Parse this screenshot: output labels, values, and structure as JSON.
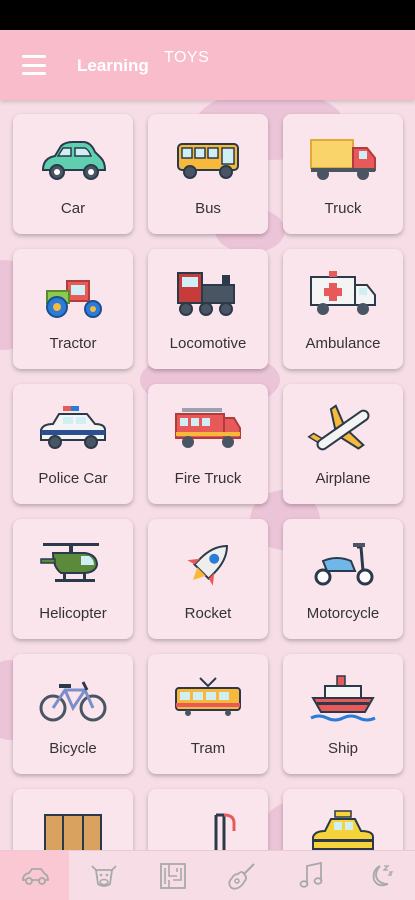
{
  "app_bar": {
    "title": "Learning",
    "subtitle": "TOYS"
  },
  "items": [
    {
      "label": "Car",
      "icon": "car-icon"
    },
    {
      "label": "Bus",
      "icon": "bus-icon"
    },
    {
      "label": "Truck",
      "icon": "truck-icon"
    },
    {
      "label": "Tractor",
      "icon": "tractor-icon"
    },
    {
      "label": "Locomotive",
      "icon": "locomotive-icon"
    },
    {
      "label": "Ambulance",
      "icon": "ambulance-icon"
    },
    {
      "label": "Police Car",
      "icon": "police-car-icon"
    },
    {
      "label": "Fire Truck",
      "icon": "fire-truck-icon"
    },
    {
      "label": "Airplane",
      "icon": "airplane-icon"
    },
    {
      "label": "Helicopter",
      "icon": "helicopter-icon"
    },
    {
      "label": "Rocket",
      "icon": "rocket-icon"
    },
    {
      "label": "Motorcycle",
      "icon": "motorcycle-icon"
    },
    {
      "label": "Bicycle",
      "icon": "bicycle-icon"
    },
    {
      "label": "Tram",
      "icon": "tram-icon"
    },
    {
      "label": "Ship",
      "icon": "ship-icon"
    },
    {
      "label": "",
      "icon": "crate-icon"
    },
    {
      "label": "",
      "icon": "crane-icon"
    },
    {
      "label": "",
      "icon": "taxi-icon"
    }
  ],
  "bottom_nav": [
    {
      "icon": "car-outline-icon",
      "active": true
    },
    {
      "icon": "cow-icon",
      "active": false
    },
    {
      "icon": "maze-icon",
      "active": false
    },
    {
      "icon": "guitar-icon",
      "active": false
    },
    {
      "icon": "music-note-icon",
      "active": false
    },
    {
      "icon": "moon-sleep-icon",
      "active": false
    }
  ],
  "colors": {
    "app_bar": "#f8bccb",
    "background": "#f6dde6",
    "card": "#fbe5ec",
    "blob": "#eac0d5",
    "nav_active": "#f9c8d3",
    "nav_icon": "#a9a9a9"
  }
}
